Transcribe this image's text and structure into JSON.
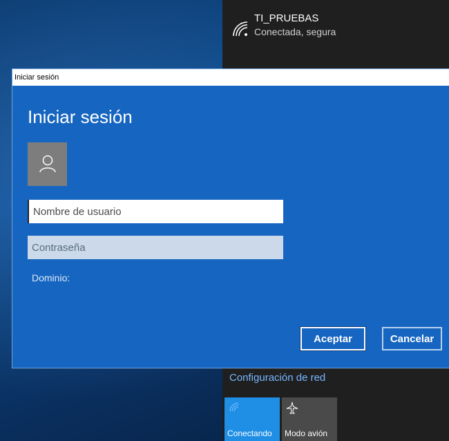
{
  "network": {
    "ssid": "TI_PRUEBAS",
    "status": "Conectada, segura",
    "settings_link": "Configuración de red",
    "quick_actions": [
      {
        "label": "Conectando",
        "icon": "wifi-icon"
      },
      {
        "label": "Modo avión",
        "icon": "airplane-icon"
      }
    ]
  },
  "dialog": {
    "window_title": "Iniciar sesión",
    "heading": "Iniciar sesión",
    "username_placeholder": "Nombre de usuario",
    "password_placeholder": "Contraseña",
    "domain_label": "Dominio:",
    "ok_label": "Aceptar",
    "cancel_label": "Cancelar",
    "avatar_icon": "user-icon"
  },
  "colors": {
    "dialog_bg": "#1665c1",
    "flyout_bg": "#1f1f1f",
    "accent": "#1f8fe6",
    "link": "#78b6ff"
  }
}
